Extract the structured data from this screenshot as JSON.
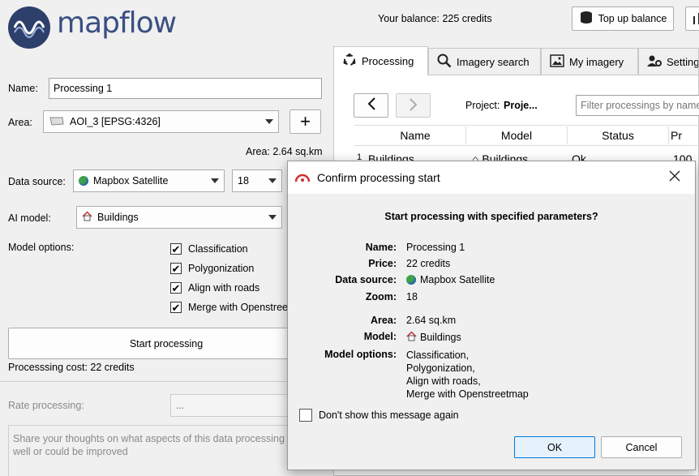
{
  "header": {
    "logo_text": "mapflow",
    "balance": "Your balance: 225 credits",
    "topup_label": "Top up balance"
  },
  "form": {
    "name_label": "Name:",
    "name_value": "Processing 1",
    "area_label": "Area:",
    "area_value": "AOI_3 [EPSG:4326]",
    "area_size": "Area: 2.64 sq.km",
    "data_source_label": "Data source:",
    "data_source_value": "Mapbox Satellite",
    "zoom_value": "18",
    "ai_model_label": "AI model:",
    "ai_model_value": "Buildings",
    "model_options_label": "Model options:",
    "options": [
      {
        "label": "Classification",
        "checked": true
      },
      {
        "label": "Polygonization",
        "checked": true
      },
      {
        "label": "Align with roads",
        "checked": true
      },
      {
        "label": "Merge with Openstree",
        "checked": true
      }
    ],
    "start_button": "Start processing",
    "cost": "Processsing cost: 22 credits",
    "rate_label": "Rate processing:",
    "rate_value": "...",
    "feedback_placeholder_line1": "Share your thoughts on what aspects of this data processing",
    "feedback_placeholder_line2": "well or could be improved"
  },
  "tabs": [
    {
      "label": "Processing",
      "icon": "processing-icon",
      "active": true
    },
    {
      "label": "Imagery search",
      "icon": "search-icon",
      "active": false
    },
    {
      "label": "My imagery",
      "icon": "image-icon",
      "active": false
    },
    {
      "label": "Setting",
      "icon": "gear-icon",
      "active": false
    }
  ],
  "processing_panel": {
    "project_label": "Project:",
    "project_value": "Proje...",
    "filter_placeholder": "Filter processings by name",
    "columns": [
      "Name",
      "Model",
      "Status",
      "Pr"
    ],
    "rows": [
      {
        "index": "1",
        "name": "Buildings",
        "model": "Buildings",
        "status": "Ok",
        "progress": "100"
      }
    ]
  },
  "dialog": {
    "title": "Confirm processing start",
    "heading": "Start processing with specified parameters?",
    "fields": [
      {
        "key": "Name:",
        "value": "Processing 1"
      },
      {
        "key": "Price:",
        "value": "22 credits"
      },
      {
        "key": "Data source:",
        "value": "Mapbox Satellite"
      },
      {
        "key": "Zoom:",
        "value": "18"
      },
      {
        "key": "Area:",
        "value": "2.64 sq.km"
      },
      {
        "key": "Model:",
        "value": "Buildings"
      },
      {
        "key": "Model options:",
        "value": "Classification,"
      }
    ],
    "model_options_extra": [
      "Polygonization,",
      "Align with roads,",
      "Merge with Openstreetmap"
    ],
    "dont_show_label": "Don't show this message again",
    "ok_label": "OK",
    "cancel_label": "Cancel"
  },
  "colors": {
    "logo": "#2d3f6b",
    "accent": "#d32f2f",
    "focus_border": "#0078d7"
  }
}
